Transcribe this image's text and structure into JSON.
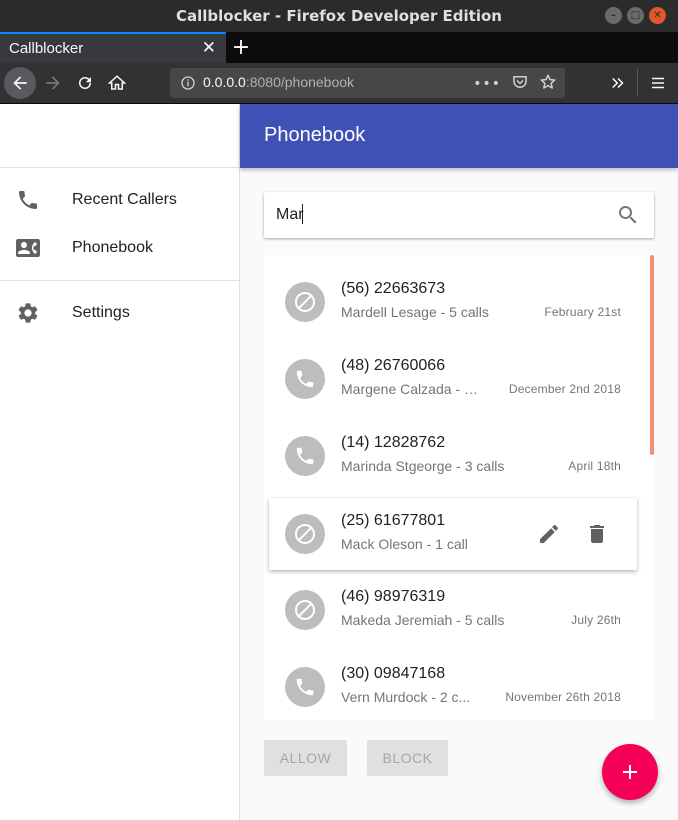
{
  "window": {
    "title": "Callblocker - Firefox Developer Edition"
  },
  "browser": {
    "tab_title": "Callblocker",
    "url_host": "0.0.0.0",
    "url_rest": ":8080/phonebook",
    "url_dots": "•••"
  },
  "sidebar": {
    "items": [
      {
        "label": "Recent Callers",
        "icon": "phone-icon"
      },
      {
        "label": "Phonebook",
        "icon": "contact-card-icon"
      },
      {
        "label": "Settings",
        "icon": "gear-icon"
      }
    ]
  },
  "appbar": {
    "title": "Phonebook"
  },
  "search": {
    "value": "Mar"
  },
  "entries": [
    {
      "phone": "(56) 22663673",
      "subtitle": "Mardell Lesage - 5 calls",
      "date": "February 21st",
      "status": "blocked"
    },
    {
      "phone": "(48) 26760066",
      "subtitle": "Margene Calzada - …",
      "date": "December 2nd 2018",
      "status": "allowed"
    },
    {
      "phone": "(14) 12828762",
      "subtitle": "Marinda Stgeorge - 3 calls",
      "date": "April 18th",
      "status": "allowed"
    },
    {
      "phone": "(25) 61677801",
      "subtitle": "Mack Oleson - 1 call",
      "date": "",
      "status": "blocked"
    },
    {
      "phone": "(46) 98976319",
      "subtitle": "Makeda Jeremiah - 5 calls",
      "date": "July 26th",
      "status": "blocked"
    },
    {
      "phone": "(30) 09847168",
      "subtitle": "Vern Murdock - 2 c...",
      "date": "November 26th 2018",
      "status": "allowed"
    }
  ],
  "actions": {
    "allow_label": "ALLOW",
    "block_label": "BLOCK",
    "fab": "add-icon"
  },
  "colors": {
    "primary": "#3f51b5",
    "accent": "#f50057",
    "scroll": "#f29075"
  }
}
